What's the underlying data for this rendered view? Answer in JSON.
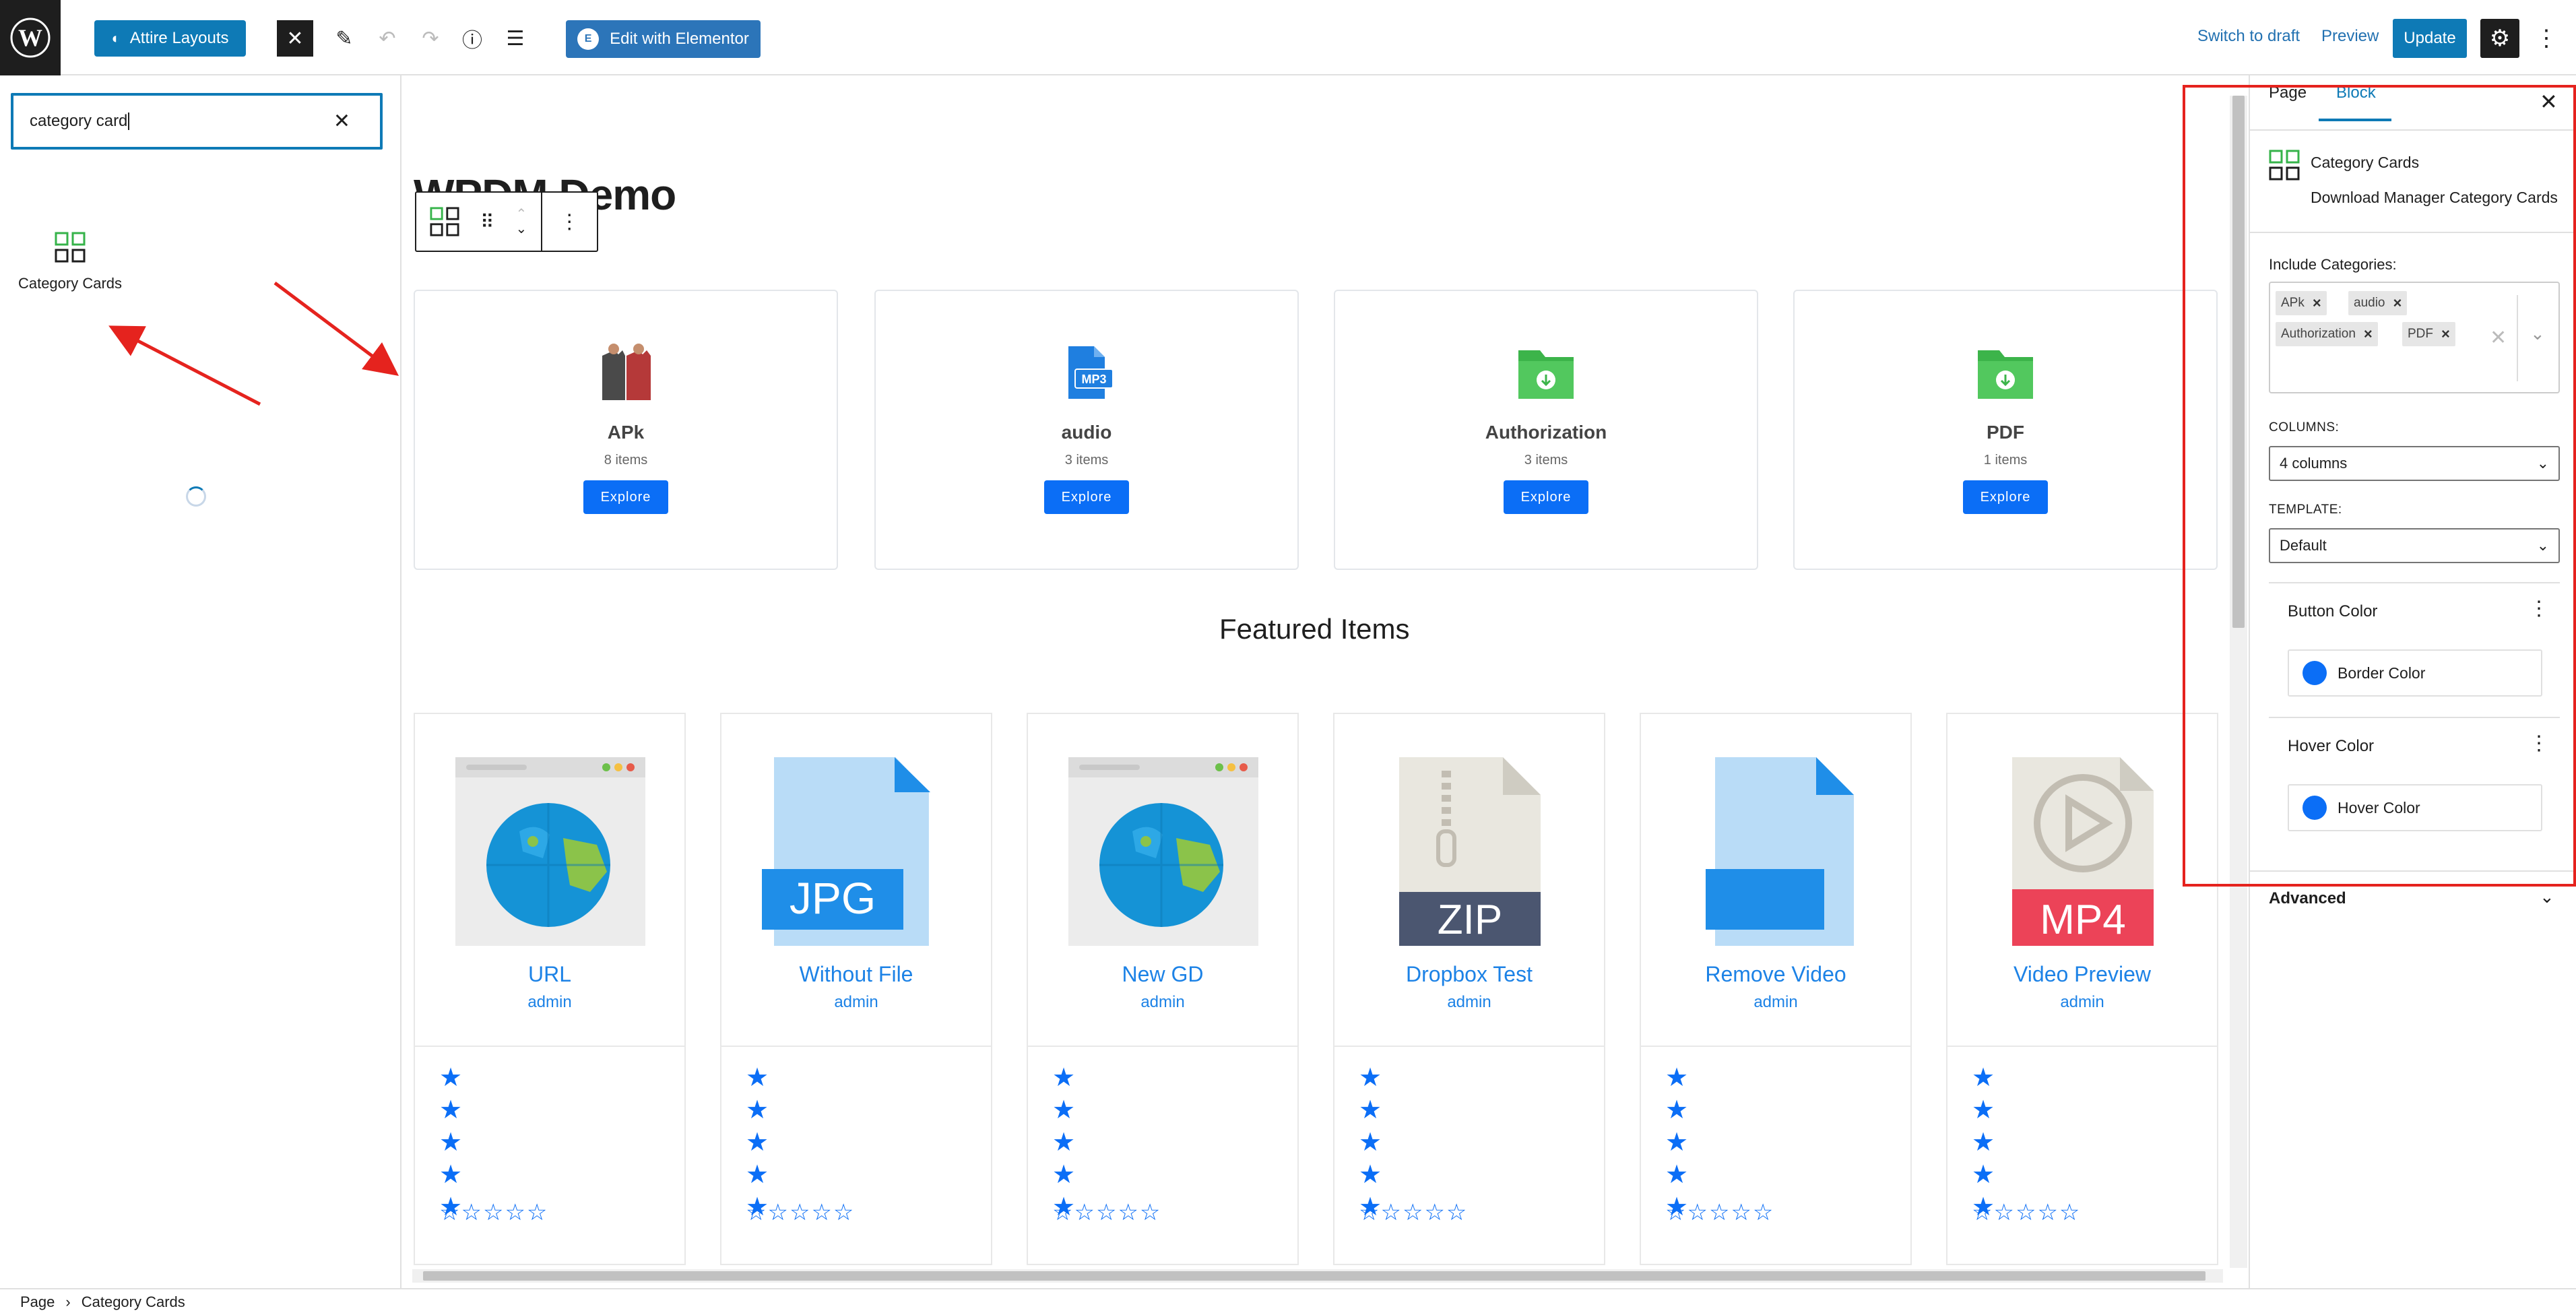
{
  "topbar": {
    "attire_label": "Attire Layouts",
    "elementor_label": "Edit with Elementor",
    "switch_draft": "Switch to draft",
    "preview": "Preview",
    "update": "Update"
  },
  "inserter": {
    "search_value": "category card",
    "result_label": "Category Cards"
  },
  "canvas": {
    "page_title": "WPDM Demo",
    "categories": [
      {
        "name": "APk",
        "count": "8 items",
        "button": "Explore"
      },
      {
        "name": "audio",
        "count": "3 items",
        "button": "Explore"
      },
      {
        "name": "Authorization",
        "count": "3 items",
        "button": "Explore"
      },
      {
        "name": "PDF",
        "count": "1 items",
        "button": "Explore"
      }
    ],
    "featured_heading": "Featured Items",
    "items": [
      {
        "title": "URL",
        "author": "admin",
        "thumb": "globe-browser-icon"
      },
      {
        "title": "Without File",
        "author": "admin",
        "thumb": "jpg-file-icon"
      },
      {
        "title": "New GD",
        "author": "admin",
        "thumb": "globe-browser-icon"
      },
      {
        "title": "Dropbox Test",
        "author": "admin",
        "thumb": "zip-file-icon"
      },
      {
        "title": "Remove Video",
        "author": "admin",
        "thumb": "blank-file-icon"
      },
      {
        "title": "Video Preview",
        "author": "admin",
        "thumb": "mp4-file-icon"
      }
    ],
    "thumb_labels": {
      "jpg": "JPG",
      "zip": "ZIP",
      "mp4": "MP4",
      "mp3": "MP3"
    }
  },
  "sidebar": {
    "tab_page": "Page",
    "tab_block": "Block",
    "block_name": "Category Cards",
    "block_desc": "Download Manager Category Cards",
    "include_label": "Include Categories:",
    "selected_categories": [
      "APk",
      "audio",
      "Authorization",
      "PDF"
    ],
    "columns_label": "COLUMNS:",
    "columns_value": "4 columns",
    "template_label": "TEMPLATE:",
    "template_value": "Default",
    "button_color_title": "Button Color",
    "border_color_label": "Border Color",
    "hover_color_title": "Hover Color",
    "hover_color_label": "Hover Color",
    "advanced_label": "Advanced"
  },
  "footer": {
    "crumb_page": "Page",
    "crumb_block": "Category Cards"
  },
  "colors": {
    "accent": "#0e7ab6",
    "button_blue": "#0b6ef6",
    "highlight_red": "#e5231e",
    "link_blue": "#1c82e6"
  }
}
